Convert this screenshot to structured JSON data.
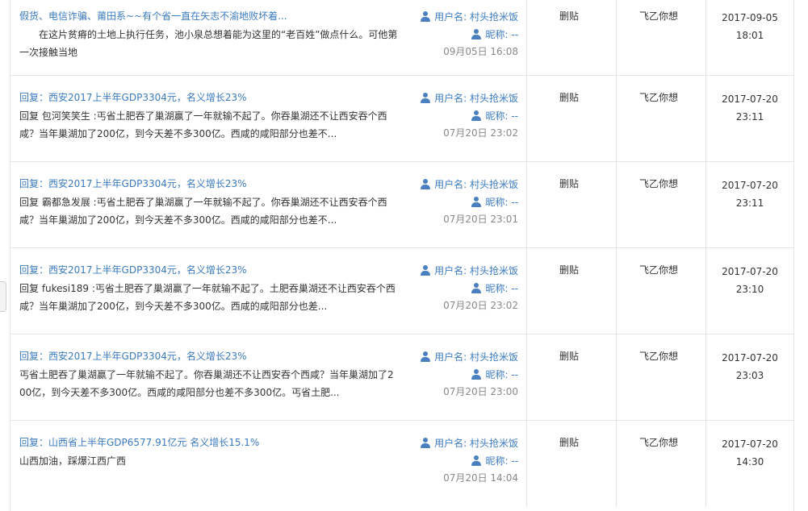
{
  "rows": [
    {
      "title": "假货、电信诈骗、莆田系~~有个省一直在矢志不渝地败坏着...",
      "excerpt": "　　在这片贫瘠的土地上执行任务，池小泉总想着能为这里的“老百姓”做点什么。可他第一次接触当地",
      "username_label": "用户名: 村头抢米饭",
      "nickname_label": "昵称: --",
      "reply_time": "09月05日 16:08",
      "action": "删贴",
      "author": "飞乙你想",
      "date": "2017-09-05",
      "time": "18:01"
    },
    {
      "title": "回复：西安2017上半年GDP3304元，名义增长23%",
      "excerpt": "回复 包河笑笑生 :丐省土肥吞了巢湖赢了一年就输不起了。你吞巢湖还不让西安吞个西咸？当年巢湖加了200亿，到今天差不多300亿。西咸的咸阳部分也差不...",
      "username_label": "用户名: 村头抢米饭",
      "nickname_label": "昵称: --",
      "reply_time": "07月20日 23:02",
      "action": "删贴",
      "author": "飞乙你想",
      "date": "2017-07-20",
      "time": "23:11"
    },
    {
      "title": "回复：西安2017上半年GDP3304元，名义增长23%",
      "excerpt": "回复 霸都急发展 :丐省土肥吞了巢湖赢了一年就输不起了。你吞巢湖还不让西安吞个西咸？当年巢湖加了200亿，到今天差不多300亿。西咸的咸阳部分也差不...",
      "username_label": "用户名: 村头抢米饭",
      "nickname_label": "昵称: --",
      "reply_time": "07月20日 23:01",
      "action": "删贴",
      "author": "飞乙你想",
      "date": "2017-07-20",
      "time": "23:11"
    },
    {
      "title": "回复：西安2017上半年GDP3304元，名义增长23%",
      "excerpt": "回复 fukesi189 :丐省土肥吞了巢湖赢了一年就输不起了。土肥吞巢湖还不让西安吞个西咸？当年巢湖加了200亿，到今天差不多300亿。西咸的咸阳部分也差...",
      "username_label": "用户名: 村头抢米饭",
      "nickname_label": "昵称: --",
      "reply_time": "07月20日 23:02",
      "action": "删贴",
      "author": "飞乙你想",
      "date": "2017-07-20",
      "time": "23:10"
    },
    {
      "title": "回复：西安2017上半年GDP3304元，名义增长23%",
      "excerpt": "丐省土肥吞了巢湖赢了一年就输不起了。你吞巢湖还不让西安吞个西咸？当年巢湖加了200亿，到今天差不多300亿。西咸的咸阳部分也差不多300亿。丐省土肥...",
      "username_label": "用户名: 村头抢米饭",
      "nickname_label": "昵称: --",
      "reply_time": "07月20日 23:00",
      "action": "删贴",
      "author": "飞乙你想",
      "date": "2017-07-20",
      "time": "23:03"
    },
    {
      "title": "回复：山西省上半年GDP6577.91亿元 名义增长15.1%",
      "excerpt": "山西加油，踩爆江西广西",
      "username_label": "用户名: 村头抢米饭",
      "nickname_label": "昵称: --",
      "reply_time": "07月20日 14:04",
      "action": "删贴",
      "author": "飞乙你想",
      "date": "2017-07-20",
      "time": "14:30"
    }
  ],
  "icons": {
    "user": "user-icon"
  },
  "colors": {
    "link": "#3b7bbf",
    "muted": "#888888",
    "border": "#e5e5e5"
  }
}
